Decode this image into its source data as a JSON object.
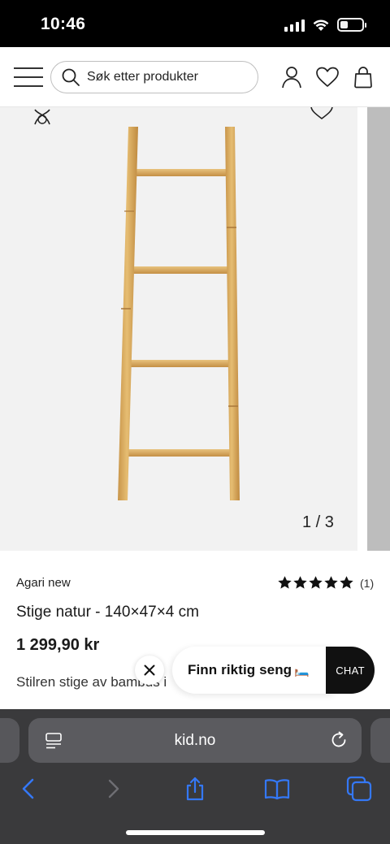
{
  "status_bar": {
    "time": "10:46",
    "battery_level": 0.35,
    "icons": [
      "cellular-signal-icon",
      "wifi-icon",
      "battery-icon"
    ]
  },
  "header": {
    "search_placeholder": "Søk etter produkter",
    "icons": [
      "hamburger-menu-icon",
      "search-icon",
      "account-icon",
      "wishlist-heart-icon",
      "shopping-bag-icon"
    ]
  },
  "gallery": {
    "counter": "1 / 3",
    "current": 1,
    "total": 3,
    "icons": [
      "compare-icon",
      "wishlist-heart-icon"
    ]
  },
  "product": {
    "brand": "Agari new",
    "rating": 5,
    "review_count": "(1)",
    "title": "Stige natur - 140×47×4 cm",
    "price": "1 299,90 kr",
    "description": "Stilren stige av bambus i"
  },
  "chat_widget": {
    "prompt_label": "Finn riktig seng",
    "prompt_emoji": "🛏️",
    "chat_label": "CHAT",
    "icons": [
      "close-icon"
    ]
  },
  "safari": {
    "url": "kid.no",
    "icons": [
      "page-menu-icon",
      "reload-icon",
      "back-icon",
      "forward-icon",
      "share-icon",
      "bookmarks-icon",
      "tabs-icon"
    ]
  },
  "colors": {
    "status_bar_bg": "#000000",
    "safari_bar_bg": "#3a3a3c",
    "safari_accent": "#3478f6",
    "chat_button_bg": "#111111",
    "ladder_wood": "#d9ad63"
  }
}
